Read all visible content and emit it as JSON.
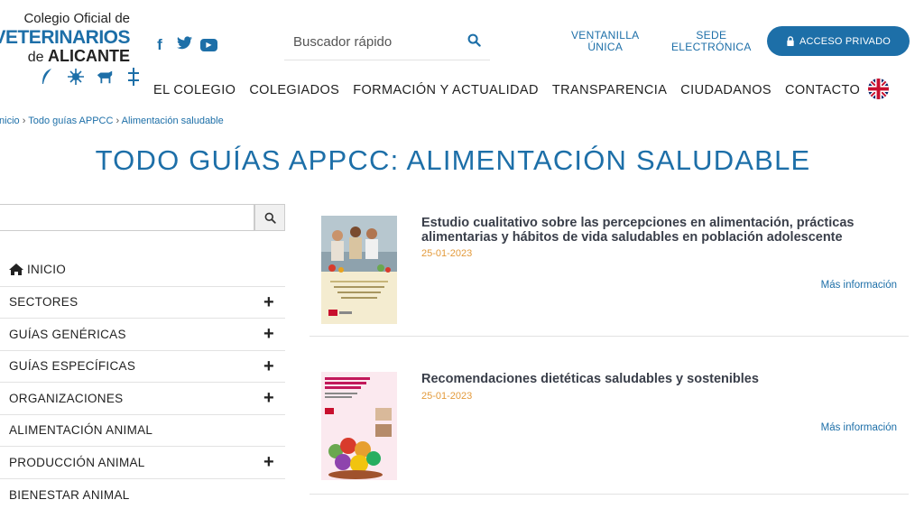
{
  "logo": {
    "line1": "Colegio Oficial de",
    "line2": "VETERINARIOS",
    "line3_pre": "de ",
    "line3_bold": "ALICANTE"
  },
  "search": {
    "placeholder": "Buscador rápido"
  },
  "toplinks": {
    "ventanilla": [
      "VENTANILLA",
      "ÚNICA"
    ],
    "sede": [
      "SEDE",
      "ELECTRÓNICA"
    ],
    "acceso": "ACCESO PRIVADO"
  },
  "nav": [
    "EL COLEGIO",
    "COLEGIADOS",
    "FORMACIÓN Y ACTUALIDAD",
    "TRANSPARENCIA",
    "CIUDADANOS",
    "CONTACTO"
  ],
  "breadcrumb": [
    "Inicio",
    "Todo guías APPCC",
    "Alimentación saludable"
  ],
  "page_title": "TODO GUÍAS APPCC: ALIMENTACIÓN SALUDABLE",
  "sidebar": {
    "items": [
      {
        "label": "INICIO",
        "expand": false
      },
      {
        "label": "SECTORES",
        "expand": true
      },
      {
        "label": "GUÍAS GENÉRICAS",
        "expand": true
      },
      {
        "label": "GUÍAS ESPECÍFICAS",
        "expand": true
      },
      {
        "label": "ORGANIZACIONES",
        "expand": true
      },
      {
        "label": "ALIMENTACIÓN ANIMAL",
        "expand": false
      },
      {
        "label": "PRODUCCIÓN ANIMAL",
        "expand": true
      },
      {
        "label": "BIENESTAR ANIMAL",
        "expand": false
      }
    ]
  },
  "articles": [
    {
      "title": "Estudio cualitativo sobre las percepciones en alimentación, prácticas alimentarias y hábitos de vida saludables en población adolescente",
      "date": "25-01-2023",
      "more": "Más información"
    },
    {
      "title": "Recomendaciones dietéticas saludables y sostenibles",
      "date": "25-01-2023",
      "more": "Más información"
    }
  ],
  "colors": {
    "primary": "#1d6fa8",
    "date": "#e39a3b"
  }
}
